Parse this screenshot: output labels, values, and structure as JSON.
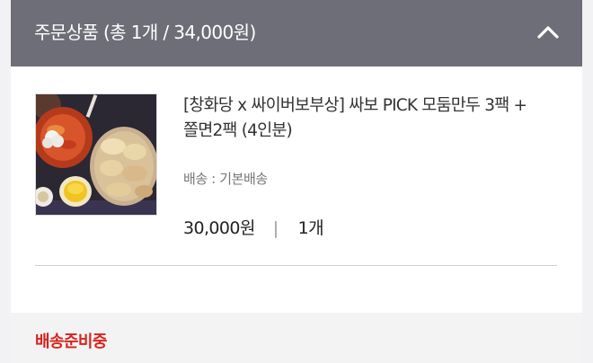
{
  "header": {
    "title": "주문상품 (총 1개 / 34,000원)",
    "collapse_icon": "chevron-up-icon"
  },
  "product": {
    "name_line1": "[창화당 x 싸이버보부상] 싸보 PICK 모둠만두 3팩 +",
    "name_line2": "쫄면2팩 (4인분)",
    "shipping": "배송 : 기본배송",
    "price": "30,000원",
    "separator": "|",
    "quantity": "1개"
  },
  "status": {
    "label": "배송준비중"
  },
  "colors": {
    "header_bg": "#6e6e78",
    "status_red": "#d6231e"
  }
}
